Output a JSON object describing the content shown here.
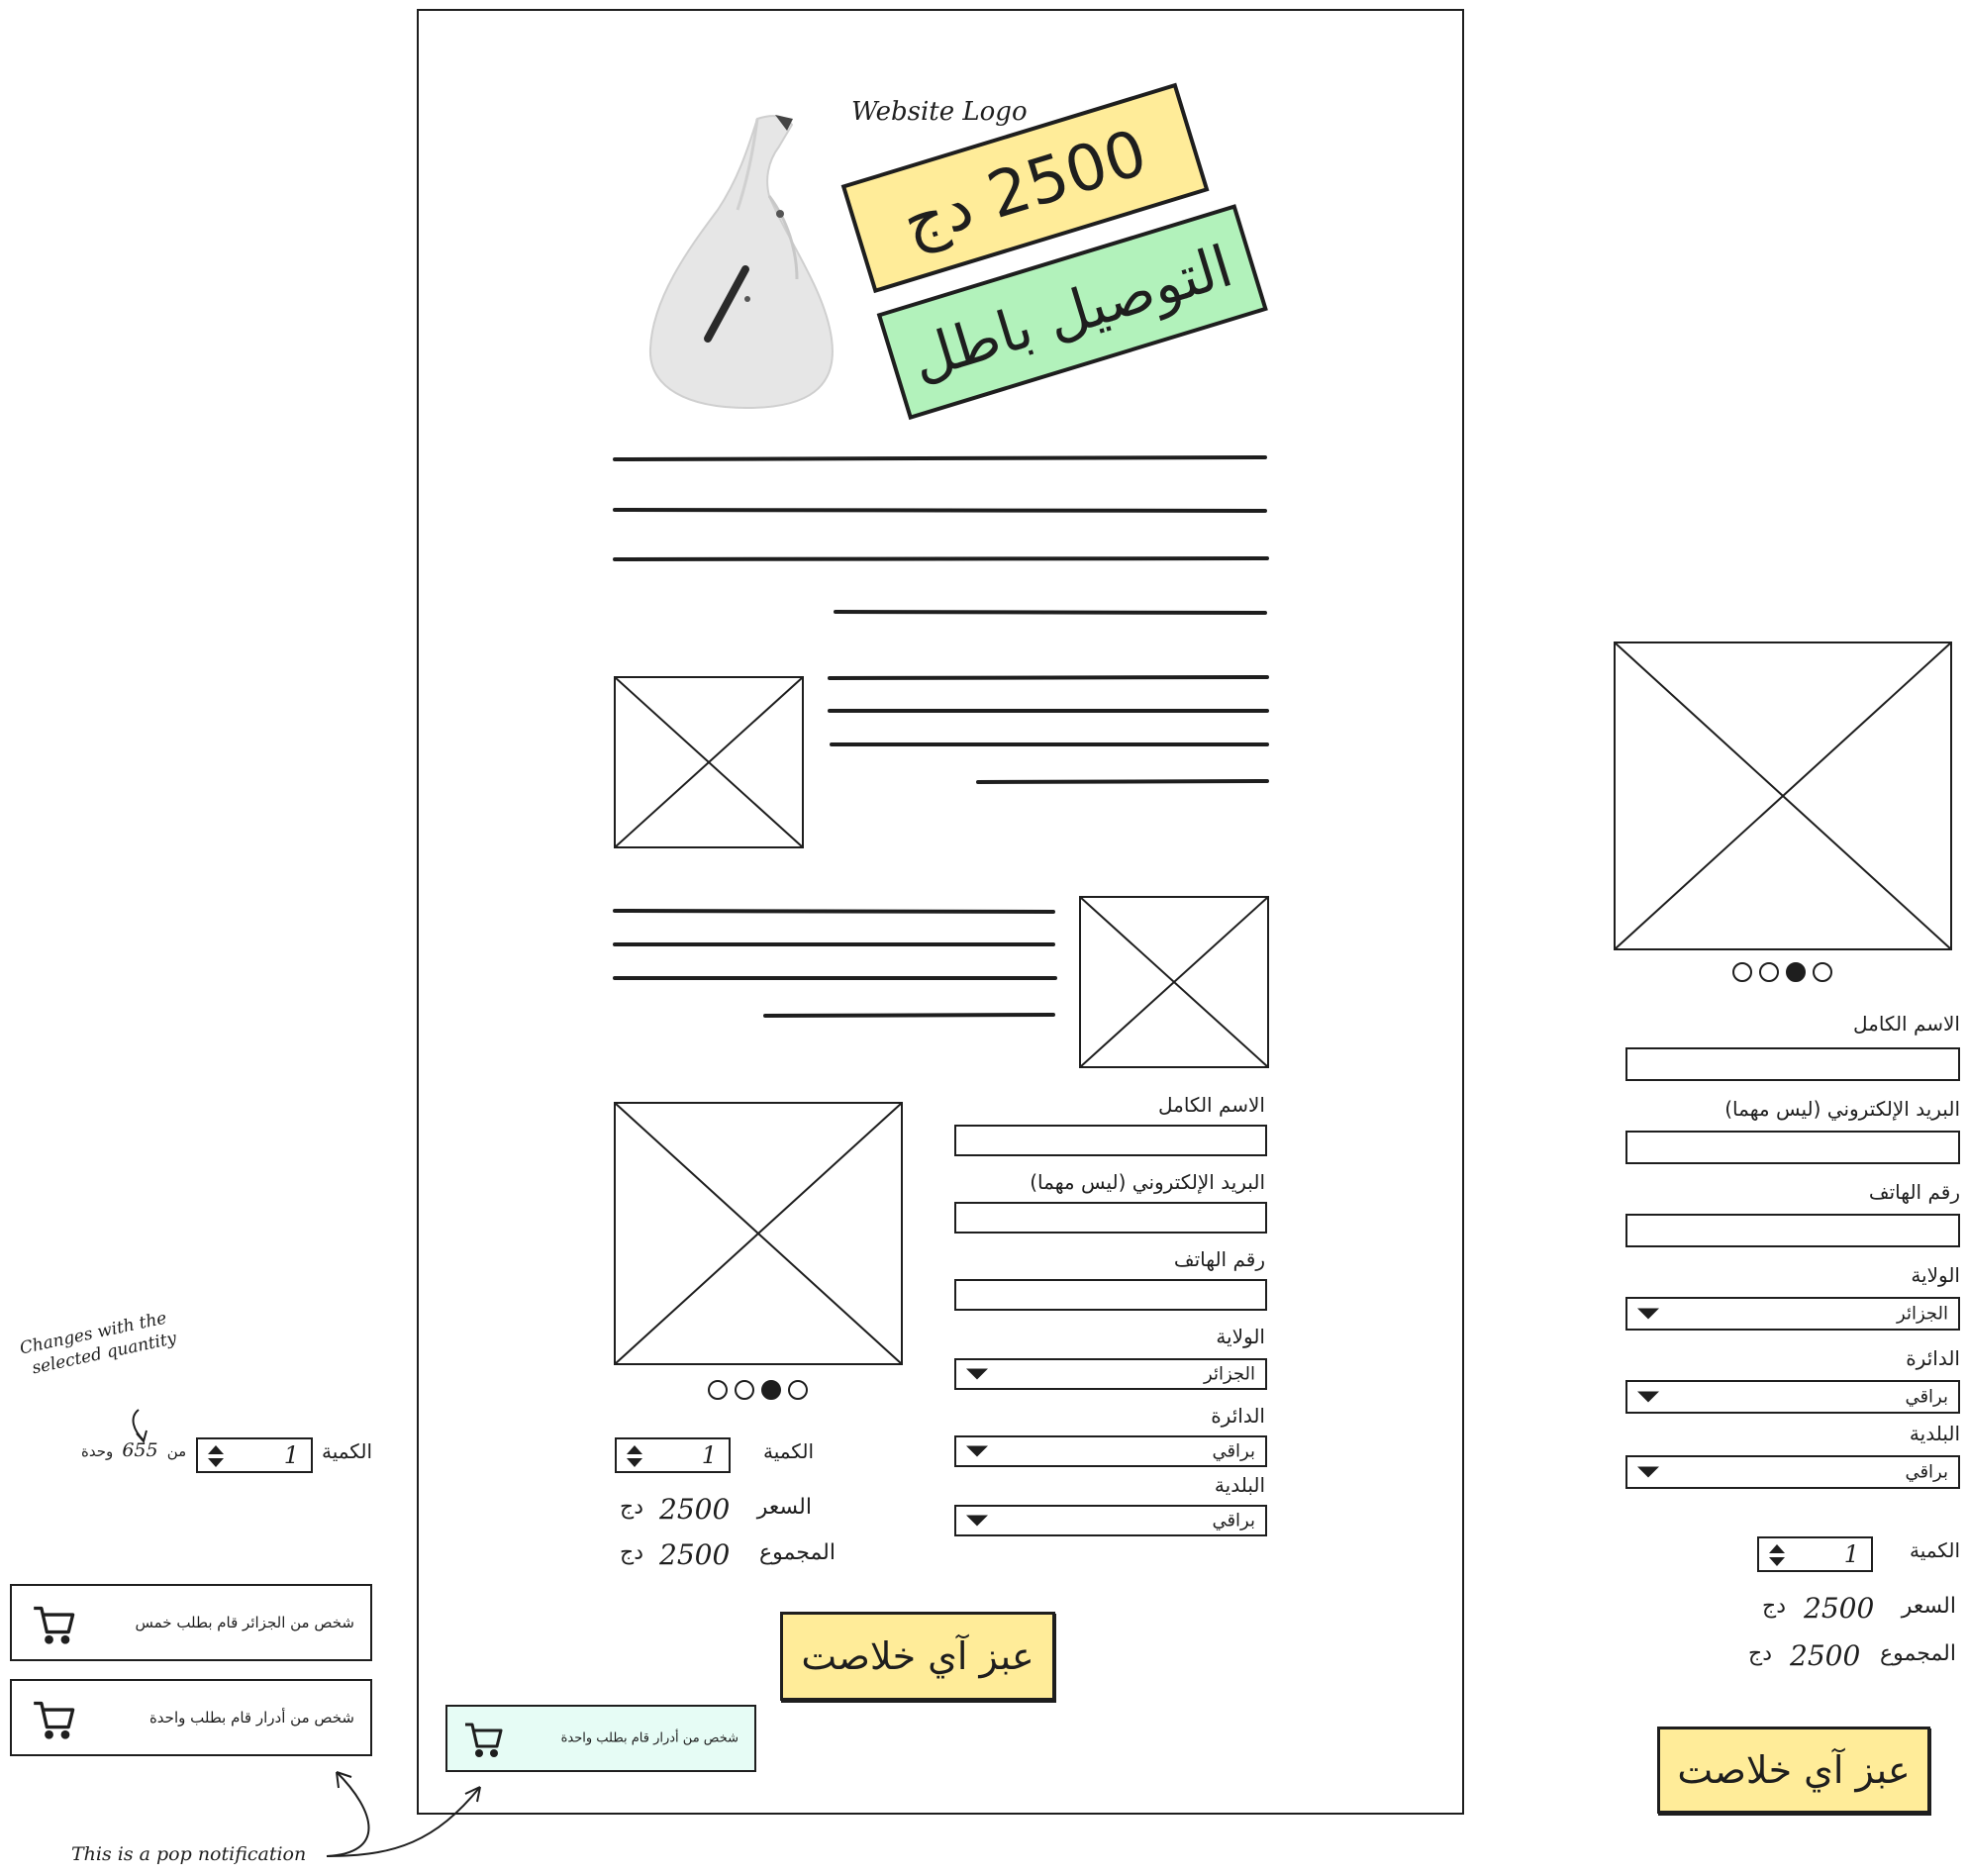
{
  "header": {
    "logo_text": "Website Logo",
    "price_badge": "2500 دج",
    "shipping_badge": "التوصيل باطل"
  },
  "colors": {
    "badge_yellow": "#ffec99",
    "badge_green": "#b2f2bb",
    "notification_bg": "#e6fcf5",
    "stroke": "#1e1e1e"
  },
  "form": {
    "full_name_label": "الاسم الكامل",
    "email_label": "البريد الإلكتروني (ليس مهما)",
    "phone_label": "رقم الهاتف",
    "state_label": "الولاية",
    "state_value": "الجزائر",
    "district_label": "الدائرة",
    "district_value": "براقي",
    "municipality_label": "البلدية",
    "municipality_value": "براقي"
  },
  "order": {
    "quantity_label": "الكمية",
    "quantity_value": "1",
    "price_label": "السعر",
    "price_value": "2500",
    "total_label": "المجموع",
    "total_value": "2500",
    "currency": "دج",
    "cta_label": "عبز آي خلاصت"
  },
  "stock": {
    "prefix": "من",
    "count": "655",
    "suffix": "وحدة"
  },
  "notifications": [
    {
      "text": "شخص من الجزائر قام بطلب خمس",
      "icon": "cart-icon"
    },
    {
      "text": "شخص من أدرار قام بطلب واحدة",
      "icon": "cart-icon"
    }
  ],
  "popup_notification": {
    "text": "شخص من أدرار قام بطلب واحدة",
    "icon": "cart-icon"
  },
  "annotations": {
    "quantity_note_line1": "Changes with the",
    "quantity_note_line2": "selected quantity",
    "popup_note": "This is a pop notification"
  },
  "carousel": {
    "dots": 4,
    "active_index": 2
  }
}
